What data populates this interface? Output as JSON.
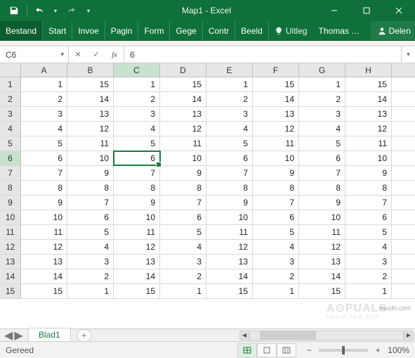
{
  "window": {
    "title": "Map1 - Excel"
  },
  "ribbon": {
    "tabs": [
      "Bestand",
      "Start",
      "Invoe",
      "Pagin",
      "Form",
      "Gege",
      "Contr",
      "Beeld"
    ],
    "tellme": "Uitleg",
    "account_name": "Thomas V…",
    "share": "Delen"
  },
  "formula_bar": {
    "namebox": "C6",
    "formula": "6"
  },
  "grid": {
    "columns": [
      "A",
      "B",
      "C",
      "D",
      "E",
      "F",
      "G",
      "H"
    ],
    "active_col": "C",
    "active_row": 6,
    "rows": [
      {
        "n": 1,
        "cells": [
          "1",
          "15",
          "1",
          "15",
          "1",
          "15",
          "1",
          "15"
        ]
      },
      {
        "n": 2,
        "cells": [
          "2",
          "14",
          "2",
          "14",
          "2",
          "14",
          "2",
          "14"
        ]
      },
      {
        "n": 3,
        "cells": [
          "3",
          "13",
          "3",
          "13",
          "3",
          "13",
          "3",
          "13"
        ]
      },
      {
        "n": 4,
        "cells": [
          "4",
          "12",
          "4",
          "12",
          "4",
          "12",
          "4",
          "12"
        ]
      },
      {
        "n": 5,
        "cells": [
          "5",
          "11",
          "5",
          "11",
          "5",
          "11",
          "5",
          "11"
        ]
      },
      {
        "n": 6,
        "cells": [
          "6",
          "10",
          "6",
          "10",
          "6",
          "10",
          "6",
          "10"
        ]
      },
      {
        "n": 7,
        "cells": [
          "7",
          "9",
          "7",
          "9",
          "7",
          "9",
          "7",
          "9"
        ]
      },
      {
        "n": 8,
        "cells": [
          "8",
          "8",
          "8",
          "8",
          "8",
          "8",
          "8",
          "8"
        ]
      },
      {
        "n": 9,
        "cells": [
          "9",
          "7",
          "9",
          "7",
          "9",
          "7",
          "9",
          "7"
        ]
      },
      {
        "n": 10,
        "cells": [
          "10",
          "6",
          "10",
          "6",
          "10",
          "6",
          "10",
          "6"
        ]
      },
      {
        "n": 11,
        "cells": [
          "11",
          "5",
          "11",
          "5",
          "11",
          "5",
          "11",
          "5"
        ]
      },
      {
        "n": 12,
        "cells": [
          "12",
          "4",
          "12",
          "4",
          "12",
          "4",
          "12",
          "4"
        ]
      },
      {
        "n": 13,
        "cells": [
          "13",
          "3",
          "13",
          "3",
          "13",
          "3",
          "13",
          "3"
        ]
      },
      {
        "n": 14,
        "cells": [
          "14",
          "2",
          "14",
          "2",
          "14",
          "2",
          "14",
          "2"
        ]
      },
      {
        "n": 15,
        "cells": [
          "15",
          "1",
          "15",
          "1",
          "15",
          "1",
          "15",
          "1"
        ]
      }
    ]
  },
  "sheets": {
    "active": "Blad1",
    "add_icon": "+"
  },
  "statusbar": {
    "status": "Gereed",
    "zoom": "100%"
  },
  "icons": {
    "minus": "−",
    "plus": "+",
    "caret": "▾",
    "left": "◀",
    "right": "▶",
    "check": "✓",
    "x": "✕"
  }
}
